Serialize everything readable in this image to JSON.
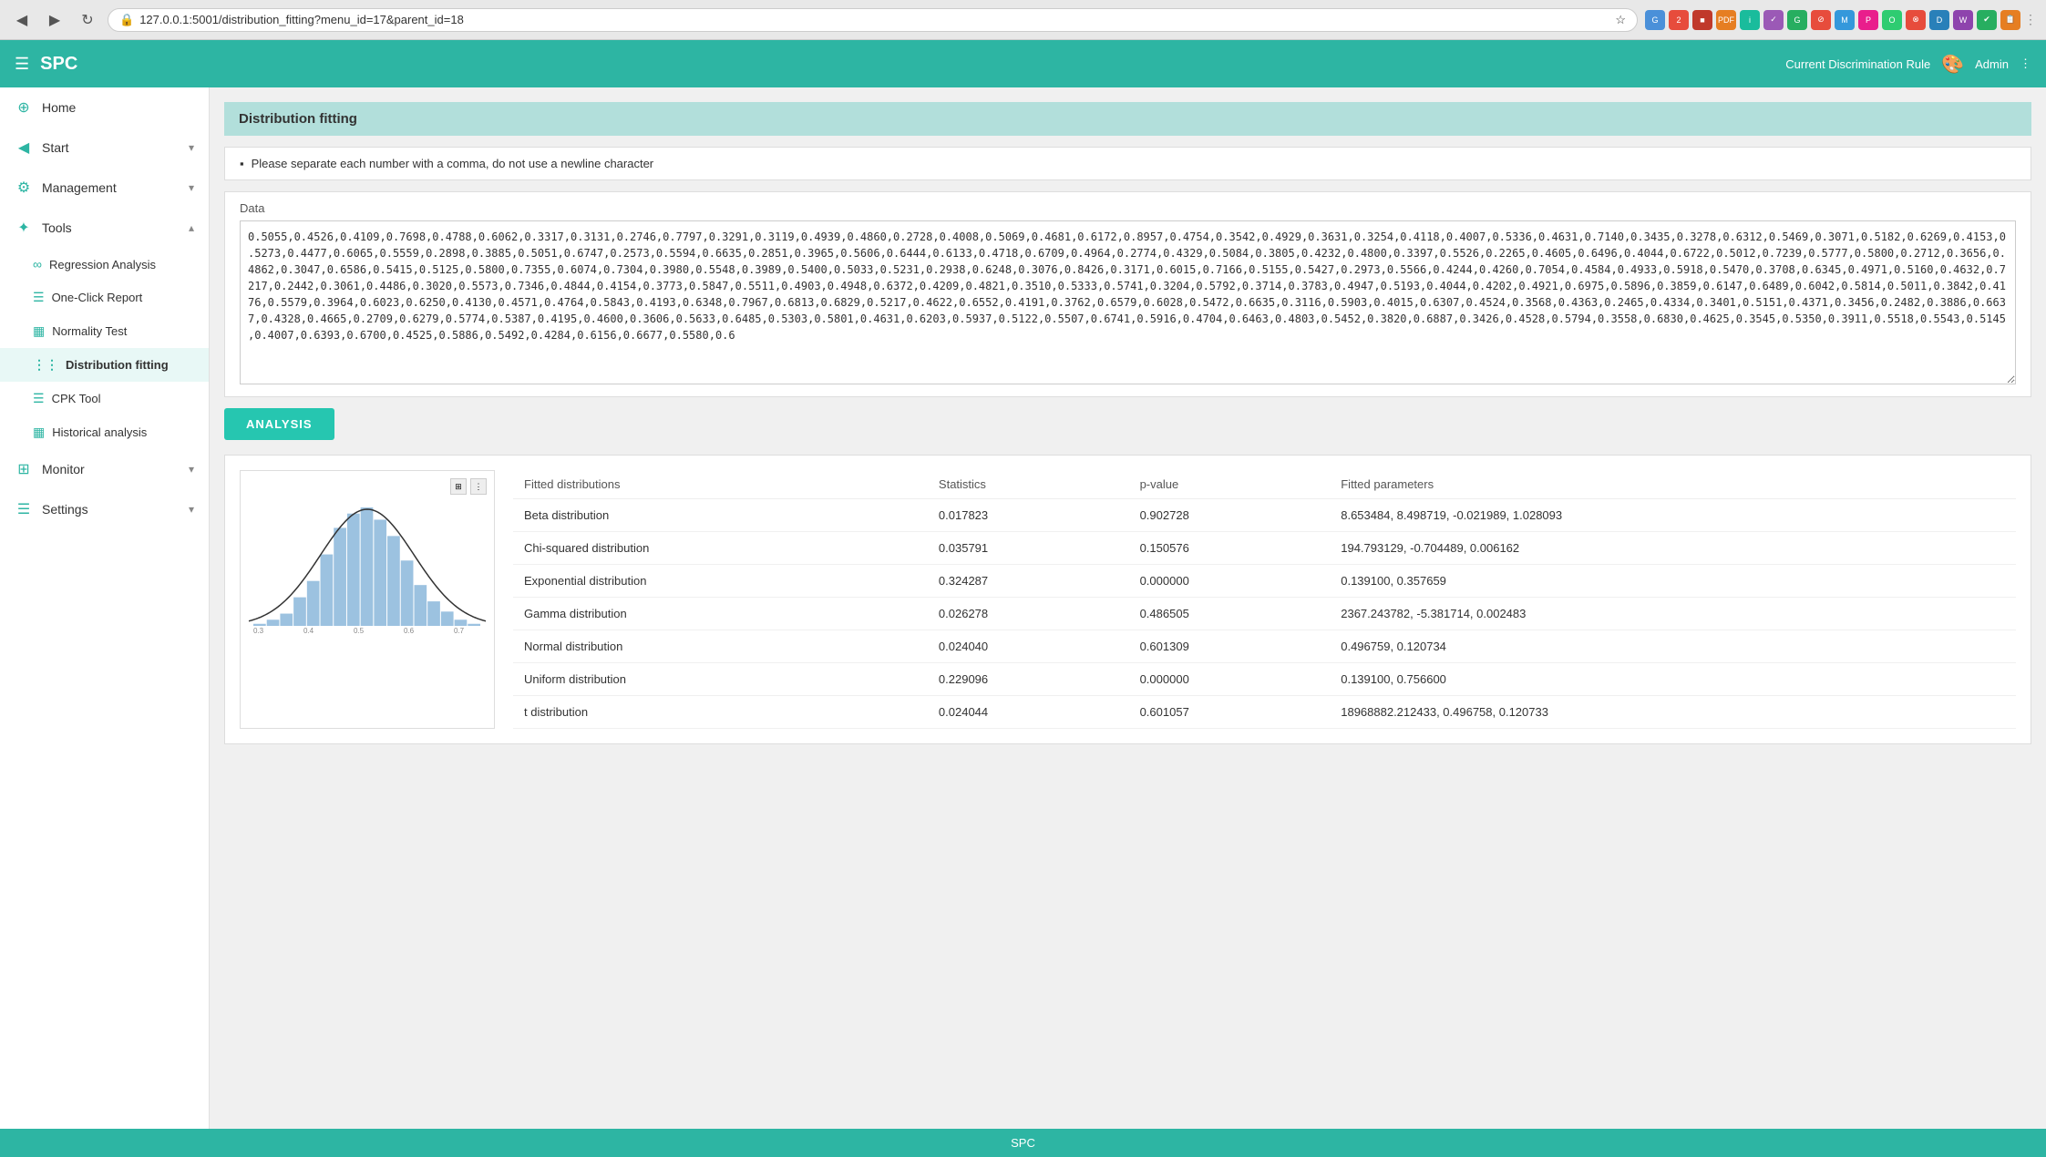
{
  "browser": {
    "url": "127.0.0.1:5001/distribution_fitting?menu_id=17&parent_id=18",
    "back_icon": "◀",
    "forward_icon": "▶",
    "reload_icon": "↻",
    "lock_icon": "🔒"
  },
  "navbar": {
    "hamburger": "☰",
    "title": "SPC",
    "right_text": "Current Discrimination Rule",
    "palette_icon": "🎨",
    "admin_text": "Admin",
    "admin_menu": "⋮"
  },
  "sidebar": {
    "home_label": "Home",
    "start_label": "Start",
    "management_label": "Management",
    "tools_label": "Tools",
    "regression_label": "Regression Analysis",
    "one_click_label": "One-Click Report",
    "normality_label": "Normality Test",
    "distribution_label": "Distribution fitting",
    "cpk_label": "CPK Tool",
    "historical_label": "Historical analysis",
    "monitor_label": "Monitor",
    "settings_label": "Settings"
  },
  "page": {
    "title": "Distribution fitting",
    "instruction": "Please separate each number with a comma, do not use a newline character",
    "data_label": "Data",
    "data_value": "0.5055,0.4526,0.4109,0.7698,0.4788,0.6062,0.3317,0.3131,0.2746,0.7797,0.3291,0.3119,0.4939,0.4860,0.2728,0.4008,0.5069,0.4681,0.6172,0.8957,0.4754,0.3542,0.4929,0.3631,0.3254,0.4118,0.4007,0.5336,0.4631,0.7140,0.3435,0.3278,0.6312,0.5469,0.3071,0.5182,0.6269,0.4153,0.5273,0.4477,0.6065,0.5559,0.2898,0.3885,0.5051,0.6747,0.2573,0.5594,0.6635,0.2851,0.3965,0.5606,0.6444,0.6133,0.4718,0.6709,0.4964,0.2774,0.4329,0.5084,0.3805,0.4232,0.4800,0.3397,0.5526,0.2265,0.4605,0.6496,0.4044,0.6722,0.5012,0.7239,0.5777,0.5800,0.2712,0.3656,0.4862,0.3047,0.6586,0.5415,0.5125,0.5800,0.7355,0.6074,0.7304,0.3980,0.5548,0.3989,0.5400,0.5033,0.5231,0.2938,0.6248,0.3076,0.8426,0.3171,0.6015,0.7166,0.5155,0.5427,0.2973,0.5566,0.4244,0.4260,0.7054,0.4584,0.4933,0.5918,0.5470,0.3708,0.6345,0.4971,0.5160,0.4632,0.7217,0.2442,0.3061,0.4486,0.3020,0.5573,0.7346,0.4844,0.4154,0.3773,0.5847,0.5511,0.4903,0.4948,0.6372,0.4209,0.4821,0.3510,0.5333,0.5741,0.3204,0.5792,0.3714,0.3783,0.4947,0.5193,0.4044,0.4202,0.4921,0.6975,0.5896,0.3859,0.6147,0.6489,0.6042,0.5814,0.5011,0.3842,0.4176,0.5579,0.3964,0.6023,0.6250,0.4130,0.4571,0.4764,0.5843,0.4193,0.6348,0.7967,0.6813,0.6829,0.5217,0.4622,0.6552,0.4191,0.3762,0.6579,0.6028,0.5472,0.6635,0.3116,0.5903,0.4015,0.6307,0.4524,0.3568,0.4363,0.2465,0.4334,0.3401,0.5151,0.4371,0.3456,0.2482,0.3886,0.6637,0.4328,0.4665,0.2709,0.6279,0.5774,0.5387,0.4195,0.4600,0.3606,0.5633,0.6485,0.5303,0.5801,0.4631,0.6203,0.5937,0.5122,0.5507,0.6741,0.5916,0.4704,0.6463,0.4803,0.5452,0.3820,0.6887,0.3426,0.4528,0.5794,0.3558,0.6830,0.4625,0.3545,0.5350,0.3911,0.5518,0.5543,0.5145,0.4007,0.6393,0.6700,0.4525,0.5886,0.5492,0.4284,0.6156,0.6677,0.5580,0.6",
    "analysis_btn": "ANALYSIS"
  },
  "table": {
    "col_fitted": "Fitted distributions",
    "col_stats": "Statistics",
    "col_pvalue": "p-value",
    "col_params": "Fitted parameters",
    "rows": [
      {
        "dist": "Beta distribution",
        "stats": "0.017823",
        "pval": "0.902728",
        "params": "8.653484, 8.498719, -0.021989, 1.028093"
      },
      {
        "dist": "Chi-squared distribution",
        "stats": "0.035791",
        "pval": "0.150576",
        "params": "194.793129, -0.704489, 0.006162"
      },
      {
        "dist": "Exponential distribution",
        "stats": "0.324287",
        "pval": "0.000000",
        "params": "0.139100, 0.357659"
      },
      {
        "dist": "Gamma distribution",
        "stats": "0.026278",
        "pval": "0.486505",
        "params": "2367.243782, -5.381714, 0.002483"
      },
      {
        "dist": "Normal distribution",
        "stats": "0.024040",
        "pval": "0.601309",
        "params": "0.496759, 0.120734"
      },
      {
        "dist": "Uniform distribution",
        "stats": "0.229096",
        "pval": "0.000000",
        "params": "0.139100, 0.756600"
      },
      {
        "dist": "t distribution",
        "stats": "0.024044",
        "pval": "0.601057",
        "params": "18968882.212433, 0.496758, 0.120733"
      }
    ]
  },
  "footer": {
    "text": "SPC"
  },
  "histogram": {
    "bars": [
      1,
      3,
      6,
      14,
      22,
      35,
      48,
      55,
      58,
      52,
      44,
      32,
      20,
      12,
      7,
      3,
      1
    ],
    "accent_color": "#7baed6"
  }
}
